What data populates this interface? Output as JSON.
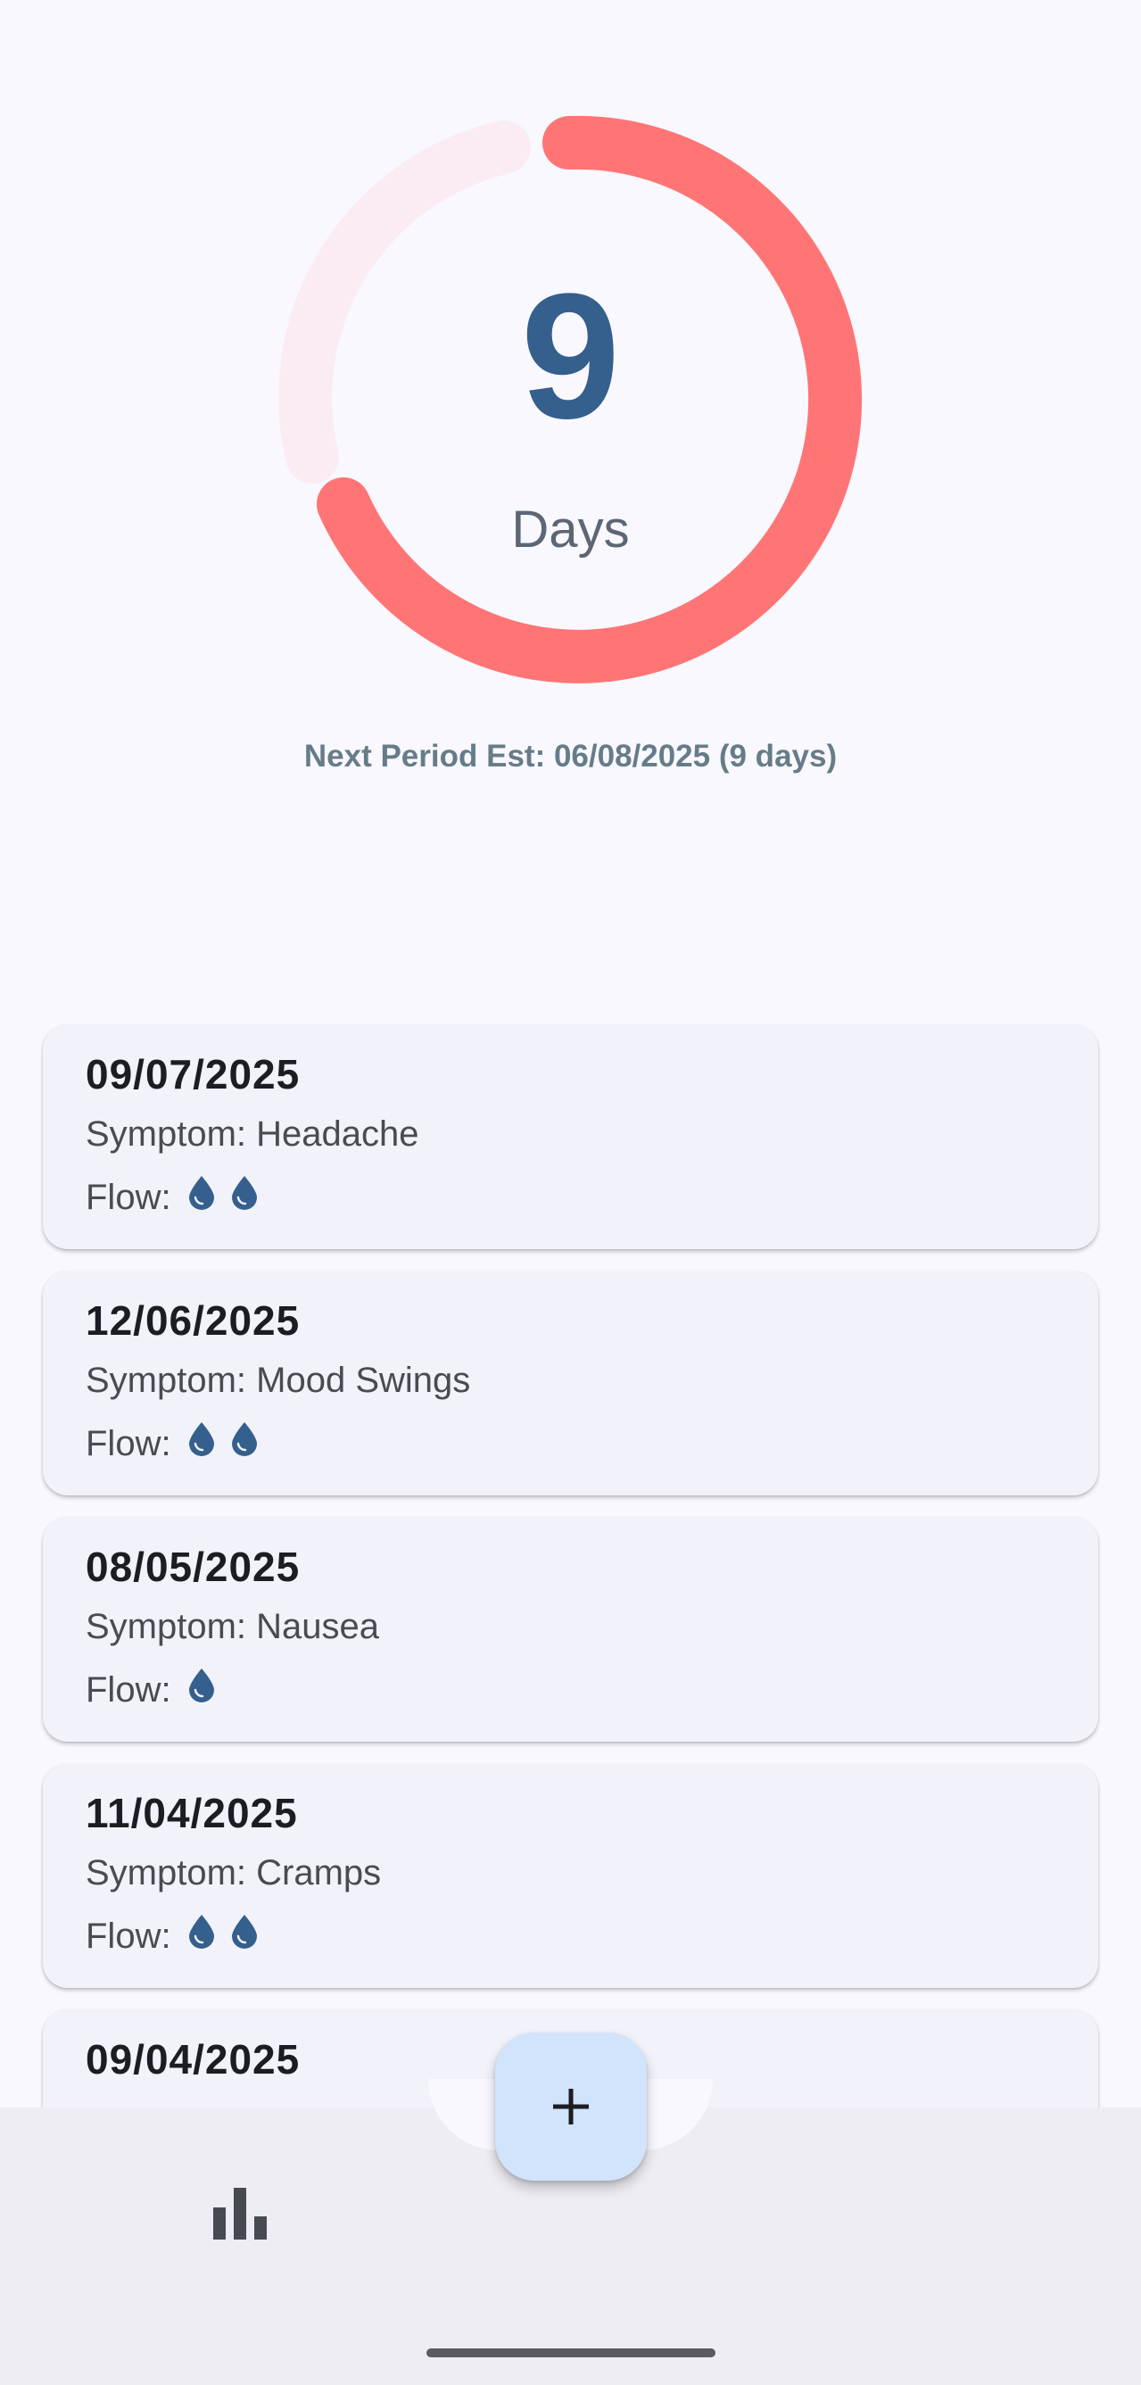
{
  "cycle": {
    "days_remaining": "9",
    "days_label": "Days",
    "progress_fraction": 0.72,
    "colors": {
      "progress": "#ff7575",
      "track": "#fbecf3",
      "number": "#355f8c"
    }
  },
  "next_period": "Next Period Est: 06/08/2025 (9 days)",
  "entries": [
    {
      "date": "09/07/2025",
      "symptom": "Symptom: Headache",
      "flow_label": "Flow:",
      "flow_drops": 2
    },
    {
      "date": "12/06/2025",
      "symptom": "Symptom: Mood Swings",
      "flow_label": "Flow:",
      "flow_drops": 2
    },
    {
      "date": "08/05/2025",
      "symptom": "Symptom: Nausea",
      "flow_label": "Flow:",
      "flow_drops": 1
    },
    {
      "date": "11/04/2025",
      "symptom": "Symptom: Cramps",
      "flow_label": "Flow:",
      "flow_drops": 2
    },
    {
      "date": "09/04/2025",
      "symptom": "",
      "flow_label": "",
      "flow_drops": 0
    }
  ],
  "bottom_nav": {
    "stats_icon": "bar-chart-icon",
    "add_icon": "plus-icon",
    "colors": {
      "fab": "#d2e3fc",
      "bar": "#ededf3",
      "icon": "#474a51"
    }
  }
}
